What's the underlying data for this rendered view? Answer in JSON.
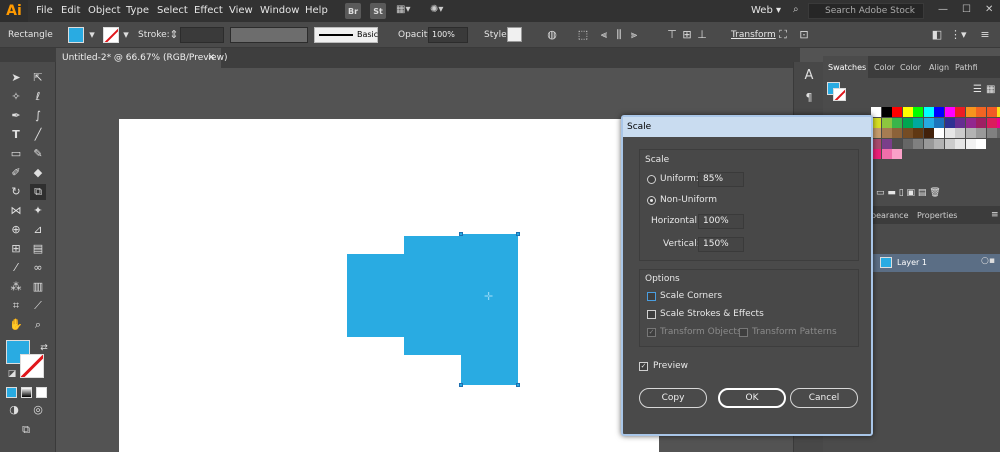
{
  "app": {
    "logo": "Ai"
  },
  "menu": [
    "File",
    "Edit",
    "Object",
    "Type",
    "Select",
    "Effect",
    "View",
    "Window",
    "Help"
  ],
  "bridge": {
    "br": "Br",
    "st": "St"
  },
  "workspace": "Web",
  "search": {
    "placeholder": "Search Adobe Stock"
  },
  "control": {
    "tool_name": "Rectangle",
    "stroke_label": "Stroke:",
    "stroke_style": "Basic",
    "opacity_label": "Opacity:",
    "opacity_value": "100%",
    "style_label": "Style:",
    "transform_label": "Transform"
  },
  "document": {
    "tab_title": "Untitled-2* @ 66.67% (RGB/Preview)"
  },
  "panels": {
    "tabs": [
      "Swatches",
      "Color",
      "Color",
      "Align",
      "Pathfi"
    ],
    "lower_tabs": [
      "pearance",
      "Properties"
    ],
    "layer_name": "Layer 1"
  },
  "colors": {
    "fill": "#29abe2"
  },
  "dialog": {
    "title": "Scale",
    "scale_group": "Scale",
    "uniform_label": "Uniform:",
    "uniform_value": "85%",
    "non_uniform_label": "Non-Uniform",
    "horizontal_label": "Horizontal:",
    "horizontal_value": "100%",
    "vertical_label": "Vertical:",
    "vertical_value": "150%",
    "options_group": "Options",
    "scale_corners": "Scale Corners",
    "scale_strokes": "Scale Strokes & Effects",
    "transform_objects": "Transform Objects",
    "transform_patterns": "Transform Patterns",
    "preview": "Preview",
    "copy": "Copy",
    "ok": "OK",
    "cancel": "Cancel"
  }
}
